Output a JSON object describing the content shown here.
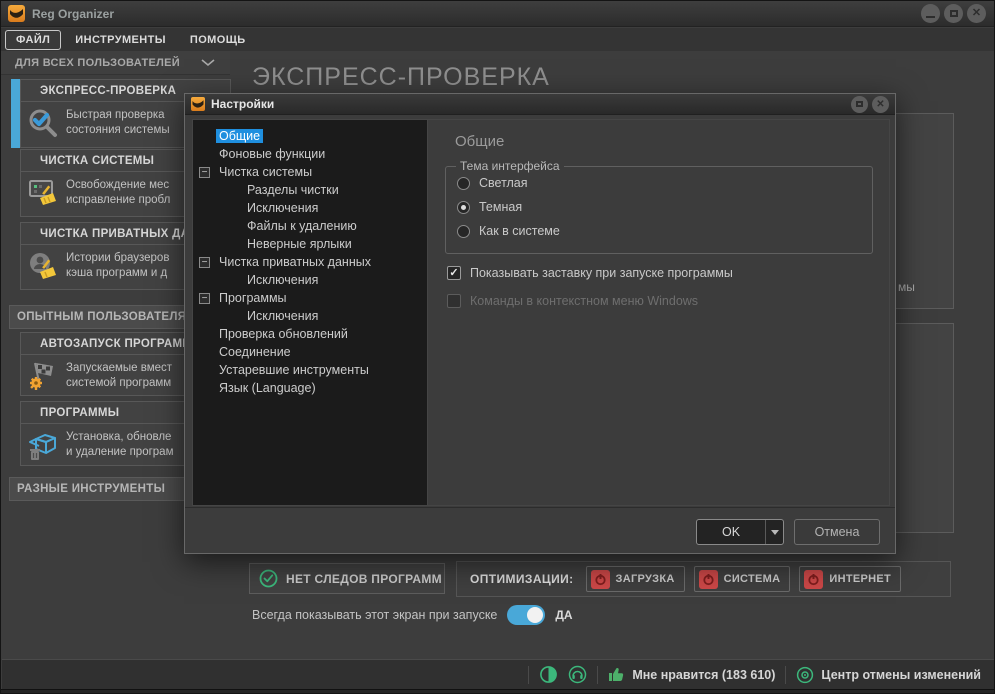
{
  "titlebar": {
    "app_title": "Reg Organizer"
  },
  "menu": {
    "file": "ФАЙЛ",
    "tools": "ИНСТРУМЕНТЫ",
    "help": "ПОМОЩЬ"
  },
  "filter": {
    "label": "ДЛЯ ВСЕХ ПОЛЬЗОВАТЕЛЕЙ"
  },
  "main": {
    "title": "ЭКСПРЕСС-ПРОВЕРКА",
    "bg_text_fragment": "мы"
  },
  "sidebar": {
    "sections": [
      "ОПЫТНЫМ ПОЛЬЗОВАТЕЛЯ",
      "РАЗНЫЕ ИНСТРУМЕНТЫ"
    ],
    "items": [
      {
        "title": "ЭКСПРЕСС-ПРОВЕРКА",
        "desc1": "Быстрая проверка",
        "desc2": "состояния системы"
      },
      {
        "title": "ЧИСТКА СИСТЕМЫ",
        "desc1": "Освобождение мес",
        "desc2": "исправление пробл"
      },
      {
        "title": "ЧИСТКА ПРИВАТНЫХ ДАН",
        "desc1": "Истории браузеров",
        "desc2": "кэша программ и д"
      },
      {
        "title": "АВТОЗАПУСК ПРОГРАММ",
        "desc1": "Запускаемые вмест",
        "desc2": "системой программ"
      },
      {
        "title": "ПРОГРАММЫ",
        "desc1": "Установка, обновле",
        "desc2": "и удаление програм"
      }
    ]
  },
  "dialog": {
    "title": "Настройки",
    "tree": [
      {
        "label": "Общие"
      },
      {
        "label": "Фоновые функции"
      },
      {
        "label": "Чистка системы"
      },
      {
        "label": "Разделы чистки"
      },
      {
        "label": "Исключения"
      },
      {
        "label": "Файлы к удалению"
      },
      {
        "label": "Неверные ярлыки"
      },
      {
        "label": "Чистка приватных данных"
      },
      {
        "label": "Исключения"
      },
      {
        "label": "Программы"
      },
      {
        "label": "Исключения"
      },
      {
        "label": "Проверка обновлений"
      },
      {
        "label": "Соединение"
      },
      {
        "label": "Устаревшие инструменты"
      },
      {
        "label": "Язык (Language)"
      }
    ],
    "panel": {
      "heading": "Общие",
      "group_title": "Тема интерфейса",
      "radio_light": "Светлая",
      "radio_dark": "Темная",
      "radio_system": "Как в системе",
      "check_splash": "Показывать заставку при запуске программы",
      "check_context": "Команды в контекстном меню Windows"
    },
    "ok": "OK",
    "cancel": "Отмена"
  },
  "bottom": {
    "no_traces": "НЕТ СЛЕДОВ ПРОГРАММ",
    "optimizations": "ОПТИМИЗАЦИИ:",
    "opt1": "ЗАГРУЗКА",
    "opt2": "СИСТЕМА",
    "opt3": "ИНТЕРНЕТ",
    "toggle_label": "Всегда показывать этот экран при запуске",
    "toggle_value": "ДА"
  },
  "statusbar": {
    "like": "Мне нравится (183 610)",
    "undo": "Центр отмены изменений"
  },
  "colors": {
    "accent_blue": "#4aa8d8",
    "selection_blue": "#1f8fdf",
    "teal_green": "#3cb87c",
    "badge_red": "#cb4747",
    "toggle_blue": "#49a8d8",
    "logo_orange": "#e8902a"
  }
}
